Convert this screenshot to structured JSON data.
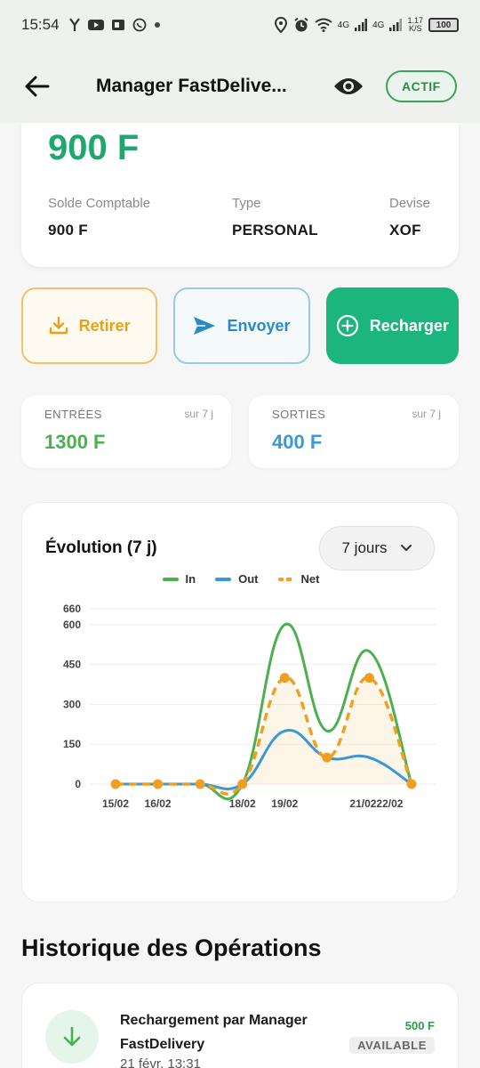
{
  "status_bar": {
    "time": "15:54",
    "net1": "4G",
    "net2": "4G",
    "speed": "1.17",
    "speed_unit": "K/S",
    "battery": "100"
  },
  "app_bar": {
    "title": "Manager FastDelive...",
    "status": "ACTIF"
  },
  "balance": {
    "amount": "900 F",
    "accounting_label": "Solde Comptable",
    "accounting_value": "900 F",
    "type_label": "Type",
    "type_value": "PERSONAL",
    "currency_label": "Devise",
    "currency_value": "XOF"
  },
  "actions": {
    "withdraw": "Retirer",
    "send": "Envoyer",
    "topup": "Recharger"
  },
  "stats": {
    "in_label": "ENTRÉES",
    "in_period": "sur 7 j",
    "in_value": "1300 F",
    "out_label": "SORTIES",
    "out_period": "sur 7 j",
    "out_value": "400 F"
  },
  "chart_card": {
    "title": "Évolution (7 j)",
    "range": "7 jours"
  },
  "colors": {
    "in": "#4caf50",
    "out": "#3a98d6",
    "net": "#f0a020",
    "accent": "#1bb57d"
  },
  "chart_data": {
    "type": "line",
    "x": [
      "15/02",
      "16/02",
      "17/02",
      "18/02",
      "19/02",
      "20/02",
      "21/02",
      "22/02"
    ],
    "x_tick_labels": [
      "15/02",
      "16/02",
      "18/02",
      "19/02",
      "21/02",
      "22/02"
    ],
    "y_ticks": [
      "0",
      "150",
      "300",
      "450",
      "600",
      "660"
    ],
    "ylim": [
      0,
      660
    ],
    "grid": true,
    "legend": "top-center",
    "series": [
      {
        "name": "In",
        "values": [
          0,
          0,
          0,
          0,
          600,
          200,
          500,
          0
        ]
      },
      {
        "name": "Out",
        "values": [
          0,
          0,
          0,
          0,
          200,
          100,
          100,
          0
        ]
      },
      {
        "name": "Net",
        "values": [
          0,
          0,
          0,
          0,
          400,
          100,
          400,
          0
        ]
      }
    ]
  },
  "history": {
    "title": "Historique des Opérations",
    "items": [
      {
        "title": "Rechargement par Manager FastDelivery",
        "date": "21 févr. 13:31",
        "amount": "500 F",
        "status": "AVAILABLE"
      }
    ]
  }
}
